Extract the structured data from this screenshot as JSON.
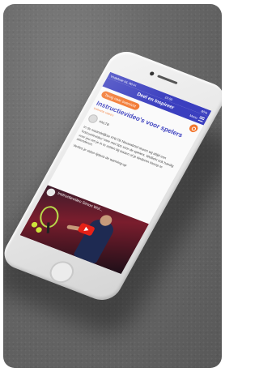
{
  "status_bar": {
    "carrier": "Vodafone NL Wi-Fi",
    "time": "10:00",
    "battery": "80%"
  },
  "app_bar": {
    "title": "Deel en Inspireer",
    "menu_label": "Menu"
  },
  "toolbar": {
    "back_label": "Terug naar overzicht"
  },
  "article": {
    "title": "Instructievideo's voor spelers",
    "subline": "Instructie video's",
    "author": "KNLTB",
    "paragraph_1": "In de maandelijkse KNLTB Nieuwsbrief sturen wij altijd een 'Instructievideo' mee met tips voor de spelers. Wellicht ook handig voor jou om je in te zetten bij lessen of je kinderen hierop te attenderen.",
    "paragraph_2": "Verlies je video tijdens de warming-up"
  },
  "video": {
    "title": "Instructievideo Simon Wol..."
  },
  "colors": {
    "brand_blue": "#3b3fbf",
    "accent_orange": "#f2762e",
    "play_red": "#e62117"
  }
}
